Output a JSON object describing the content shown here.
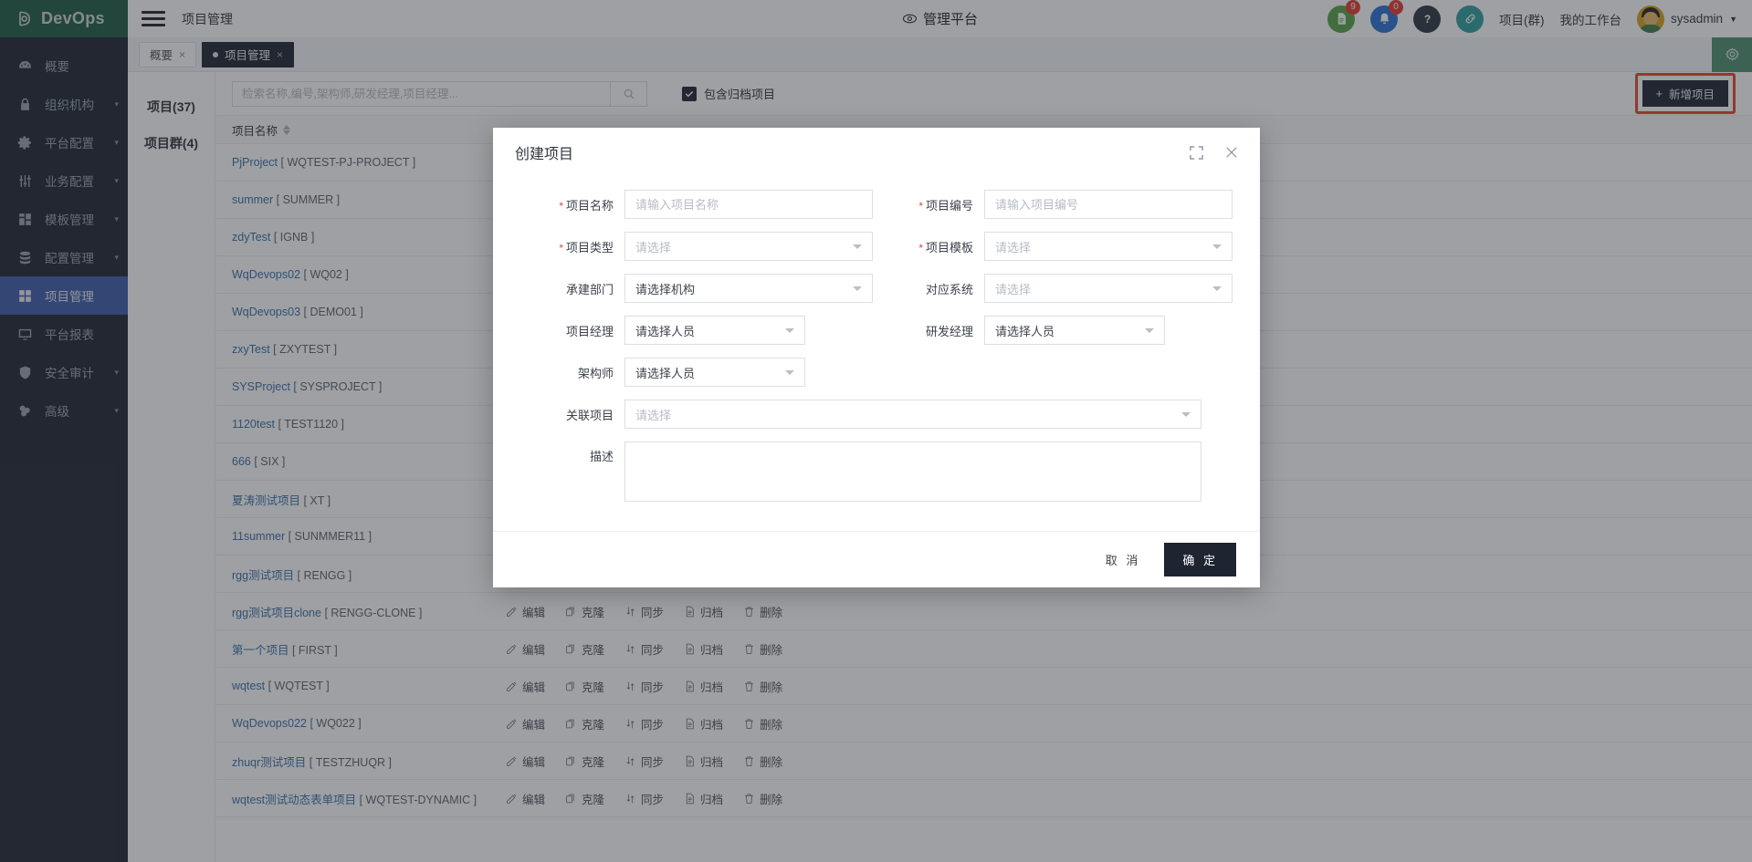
{
  "brand": {
    "name": "DevOps"
  },
  "header": {
    "page_title": "项目管理",
    "center_title": "管理平台",
    "doc_badge": "9",
    "bell_badge": "0",
    "links": [
      "项目(群)",
      "我的工作台"
    ],
    "user": "sysadmin"
  },
  "tabs": [
    {
      "label": "概要",
      "active": false,
      "close": "×"
    },
    {
      "label": "项目管理",
      "active": true,
      "close": "×"
    }
  ],
  "categories": [
    {
      "label": "项目(37)",
      "active": true
    },
    {
      "label": "项目群(4)",
      "active": false
    }
  ],
  "sidebar": {
    "items": [
      {
        "label": "概要",
        "icon": "dashboard-icon",
        "expand": false,
        "active": false
      },
      {
        "label": "组织机构",
        "icon": "lock-icon",
        "expand": true,
        "active": false
      },
      {
        "label": "平台配置",
        "icon": "gear-icon",
        "expand": true,
        "active": false
      },
      {
        "label": "业务配置",
        "icon": "sliders-icon",
        "expand": true,
        "active": false
      },
      {
        "label": "模板管理",
        "icon": "template-icon",
        "expand": true,
        "active": false
      },
      {
        "label": "配置管理",
        "icon": "database-icon",
        "expand": true,
        "active": false
      },
      {
        "label": "项目管理",
        "icon": "grid-icon",
        "expand": false,
        "active": true
      },
      {
        "label": "平台报表",
        "icon": "report-icon",
        "expand": false,
        "active": false
      },
      {
        "label": "安全审计",
        "icon": "shield-icon",
        "expand": true,
        "active": false
      },
      {
        "label": "高级",
        "icon": "advanced-icon",
        "expand": true,
        "active": false
      }
    ]
  },
  "toolbar": {
    "search_placeholder": "检索名称,编号,架构师,研发经理,项目经理...",
    "search_value": "",
    "checkbox_label": "包含归档项目",
    "checkbox_checked": true,
    "add_button": "新增项目",
    "add_button_plus": "+"
  },
  "table": {
    "col_project_name": "项目名称",
    "actions": [
      "编辑",
      "克隆",
      "同步",
      "归档",
      "删除"
    ],
    "rows": [
      {
        "name": "PjProject",
        "code": "[ WQTEST-PJ-PROJECT ]"
      },
      {
        "name": "summer",
        "code": "[ SUMMER ]"
      },
      {
        "name": "zdyTest",
        "code": "[ IGNB ]"
      },
      {
        "name": "WqDevops02",
        "code": "[ WQ02 ]"
      },
      {
        "name": "WqDevops03",
        "code": "[ DEMO01 ]"
      },
      {
        "name": "zxyTest",
        "code": "[ ZXYTEST ]"
      },
      {
        "name": "SYSProject",
        "code": "[ SYSPROJECT ]"
      },
      {
        "name": "1120test",
        "code": "[ TEST1120 ]"
      },
      {
        "name": "666",
        "code": "[ SIX ]"
      },
      {
        "name": "夏涛测试项目",
        "code": "[ XT ]"
      },
      {
        "name": "11summer",
        "code": "[ SUNMMER11 ]"
      },
      {
        "name": "rgg测试项目",
        "code": "[ RENGG ]"
      },
      {
        "name": "rgg测试项目clone",
        "code": "[ RENGG-CLONE ]"
      },
      {
        "name": "第一个项目",
        "code": "[ FIRST ]"
      },
      {
        "name": "wqtest",
        "code": "[ WQTEST ]"
      },
      {
        "name": "WqDevops022",
        "code": "[ WQ022 ]"
      },
      {
        "name": "zhuqr测试项目",
        "code": "[ TESTZHUQR ]"
      },
      {
        "name": "wqtest测试动态表单项目",
        "code": "[ WQTEST-DYNAMIC ]"
      }
    ]
  },
  "modal": {
    "title": "创建项目",
    "fields": {
      "project_name": {
        "label": "项目名称",
        "required": true,
        "placeholder": "请输入项目名称",
        "value": ""
      },
      "project_code": {
        "label": "项目编号",
        "required": true,
        "placeholder": "请输入项目编号",
        "value": ""
      },
      "project_type": {
        "label": "项目类型",
        "required": true,
        "placeholder": "请选择",
        "value": ""
      },
      "project_template": {
        "label": "项目模板",
        "required": true,
        "placeholder": "请选择",
        "value": ""
      },
      "build_dept": {
        "label": "承建部门",
        "required": false,
        "placeholder": "请选择机构",
        "value": "请选择机构"
      },
      "related_system": {
        "label": "对应系统",
        "required": false,
        "placeholder": "请选择",
        "value": ""
      },
      "project_manager": {
        "label": "项目经理",
        "required": false,
        "placeholder": "请选择人员",
        "value": "请选择人员"
      },
      "dev_manager": {
        "label": "研发经理",
        "required": false,
        "placeholder": "请选择人员",
        "value": "请选择人员"
      },
      "architect": {
        "label": "架构师",
        "required": false,
        "placeholder": "请选择人员",
        "value": "请选择人员"
      },
      "related_project": {
        "label": "关联项目",
        "required": false,
        "placeholder": "请选择",
        "value": ""
      },
      "description": {
        "label": "描述",
        "required": false,
        "placeholder": "",
        "value": ""
      }
    },
    "cancel": "取 消",
    "confirm": "确 定"
  },
  "colors": {
    "brand_green": "#1f5c44",
    "sidebar_bg": "#1e2430",
    "active_nav": "#3c5ba9",
    "accent_red": "#e8452a",
    "link_blue": "#3a6ea8"
  }
}
